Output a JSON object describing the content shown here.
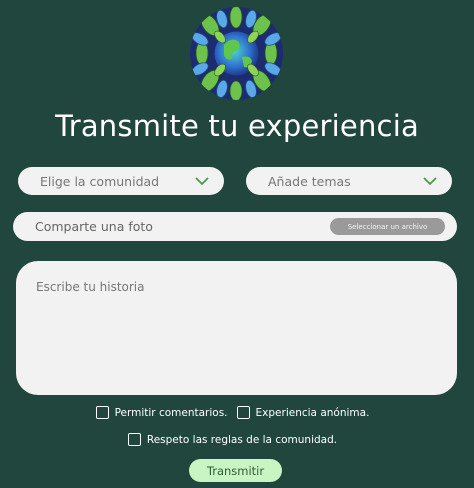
{
  "logo": {
    "icon": "earth-leaves-icon"
  },
  "title": "Transmite tu experiencia",
  "community_select": {
    "selected": "Elige la comunidad"
  },
  "topics_select": {
    "selected": "Añade temas"
  },
  "photo": {
    "placeholder": "Comparte una foto",
    "button_label": "Seleccionar un archivo"
  },
  "story": {
    "placeholder": "Escribe tu historia"
  },
  "options": {
    "allow_comments": "Permitir comentarios.",
    "anonymous": "Experiencia anónima.",
    "rules": "Respeto las reglas de la comunidad."
  },
  "submit_label": "Transmitir",
  "colors": {
    "background": "#21463e",
    "accent": "#c9f5c2",
    "chevron": "#3d9b3d"
  }
}
